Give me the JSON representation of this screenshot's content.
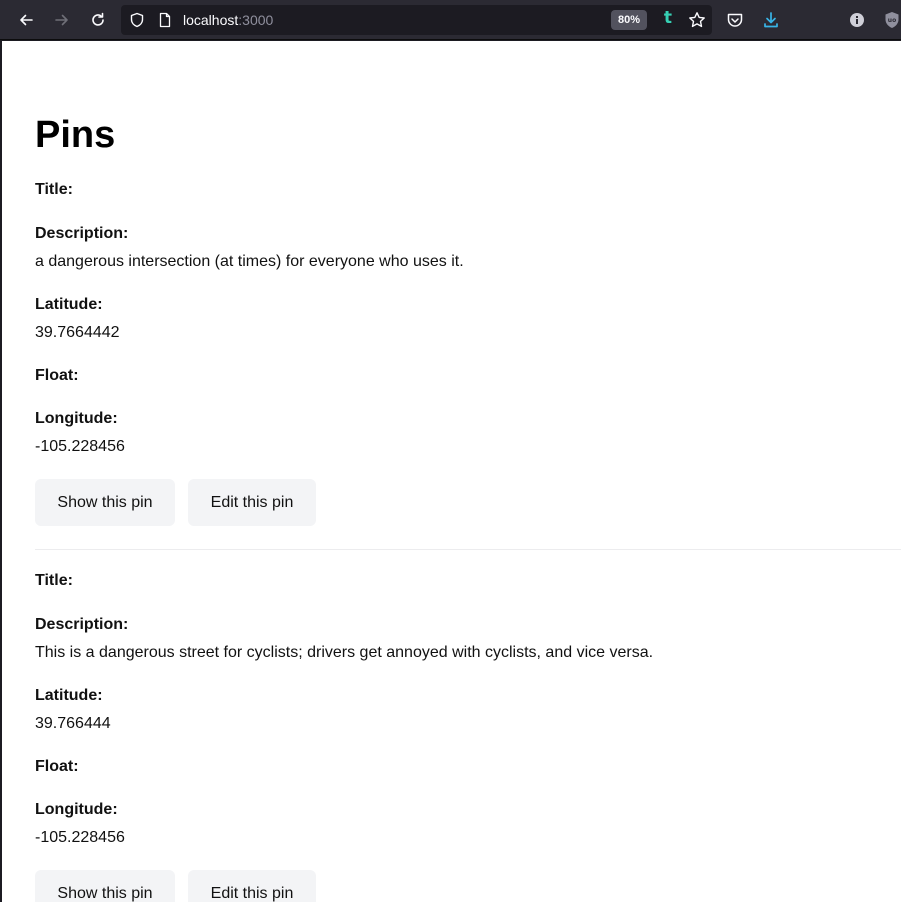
{
  "browser": {
    "url_host": "localhost",
    "url_port": ":3000",
    "zoom": "80%"
  },
  "page": {
    "title": "Pins",
    "labels": {
      "title": "Title:",
      "description": "Description:",
      "latitude": "Latitude:",
      "float": "Float:",
      "longitude": "Longitude:"
    },
    "pins": [
      {
        "title": "",
        "description": "a dangerous intersection (at times) for everyone who uses it.",
        "latitude": "39.7664442",
        "float": "",
        "longitude": "-105.228456",
        "show_label": "Show this pin",
        "edit_label": "Edit this pin"
      },
      {
        "title": "",
        "description": "This is a dangerous street for cyclists; drivers get annoyed with cyclists, and vice versa.",
        "latitude": "39.766444",
        "float": "",
        "longitude": "-105.228456",
        "show_label": "Show this pin",
        "edit_label": "Edit this pin"
      }
    ]
  }
}
